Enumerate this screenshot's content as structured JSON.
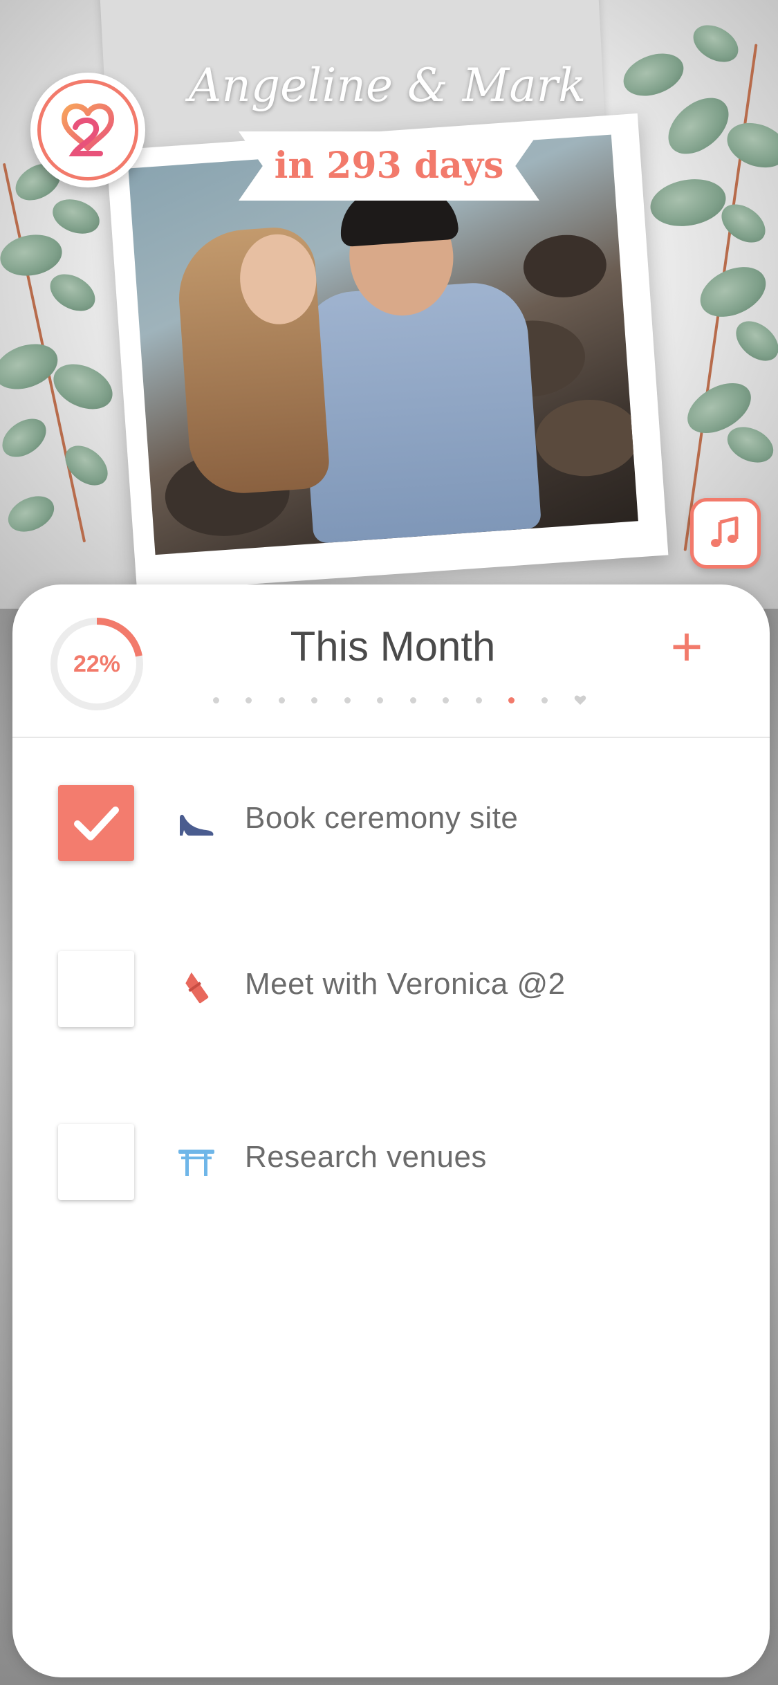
{
  "header": {
    "couple_names": "Angeline & Mark",
    "countdown": "in 293 days",
    "logo_icon": "heart-two-logo-icon",
    "music_icon": "music-note-icon",
    "accent_color": "#f27a6b"
  },
  "card": {
    "progress": {
      "label": "22%",
      "value": 0.22
    },
    "title": "This Month",
    "add_label": "+",
    "page_count": 12,
    "active_page": 9
  },
  "tasks": [
    {
      "label": "Book ceremony site",
      "checked": true,
      "icon": "high-heel-icon",
      "icon_color": "#4a5c8f"
    },
    {
      "label": "Meet with Veronica @2",
      "checked": false,
      "icon": "lipstick-icon",
      "icon_color": "#e8685c"
    },
    {
      "label": "Research venues",
      "checked": false,
      "icon": "torii-gate-icon",
      "icon_color": "#6fb6e8"
    }
  ]
}
